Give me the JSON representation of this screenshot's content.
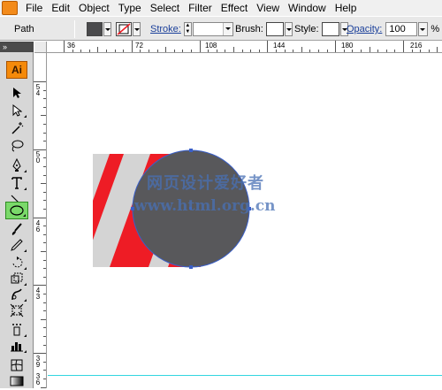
{
  "menubar": {
    "items": [
      "File",
      "Edit",
      "Object",
      "Type",
      "Select",
      "Filter",
      "Effect",
      "View",
      "Window",
      "Help"
    ]
  },
  "controlbar": {
    "selection_type": "Path",
    "stroke_label": "Stroke:",
    "brush_label": "Brush:",
    "style_label": "Style:",
    "opacity_label": "Opacity:",
    "opacity_value": "100",
    "opacity_unit": "%"
  },
  "toolbox": {
    "collapse_glyph": "»",
    "logo": "Ai",
    "tools": [
      "selection-tool",
      "direct-selection-tool",
      "magic-wand-tool",
      "lasso-tool",
      "pen-tool",
      "type-tool",
      "line-segment-tool",
      "ellipse-tool",
      "paintbrush-tool",
      "pencil-tool",
      "rotate-tool",
      "scale-tool",
      "warp-tool",
      "free-transform-tool",
      "symbol-sprayer-tool",
      "column-graph-tool",
      "mesh-tool",
      "gradient-tool"
    ],
    "active_tool": "ellipse-tool"
  },
  "rulers": {
    "horizontal": [
      "36",
      "72",
      "108",
      "144",
      "180",
      "216"
    ],
    "vertical": [
      [
        "5",
        "4"
      ],
      [
        "5",
        "0"
      ],
      [
        "4",
        "6"
      ],
      [
        "4",
        "3"
      ],
      [
        "3",
        "9"
      ],
      [
        "3",
        "6"
      ]
    ]
  },
  "colors": {
    "fill_swatch": "#4a4a4c",
    "circle_fill": "#58585b",
    "red_stripe": "#ee1c25",
    "gray_rect": "#d4d4d4",
    "guide": "#33d6e0",
    "active_tool_highlight": "#7ad96a"
  },
  "watermark": {
    "line1": "网页设计爱好者",
    "line2": "www.html.org.cn"
  }
}
